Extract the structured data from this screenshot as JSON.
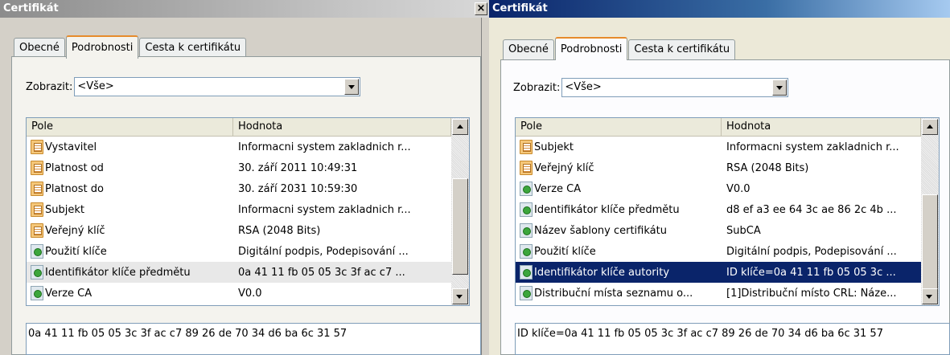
{
  "left": {
    "title": "Certifikát",
    "close_label": "×",
    "tabs": [
      "Obecné",
      "Podrobnosti",
      "Cesta k certifikátu"
    ],
    "show_label": "Zobrazit:",
    "show_value": "<Vše>",
    "columns": [
      "Pole",
      "Hodnota"
    ],
    "rows": [
      {
        "icon": "document-icon",
        "field": "Vystavitel",
        "value": "Informacni system zakladnich r..."
      },
      {
        "icon": "document-icon",
        "field": "Platnost od",
        "value": "30. září 2011 10:49:31"
      },
      {
        "icon": "document-icon",
        "field": "Platnost do",
        "value": "30. září 2031 10:59:30"
      },
      {
        "icon": "document-icon",
        "field": "Subjekt",
        "value": "Informacni system zakladnich r..."
      },
      {
        "icon": "document-icon",
        "field": "Veřejný klíč",
        "value": "RSA (2048 Bits)"
      },
      {
        "icon": "extension-icon",
        "field": "Použití klíče",
        "value": "Digitální podpis, Podepisování ..."
      },
      {
        "icon": "extension-icon",
        "field": "Identifikátor klíče předmětu",
        "value": "0a 41 11 fb 05 05 3c 3f ac c7 ..."
      },
      {
        "icon": "extension-icon",
        "field": "Verze CA",
        "value": "V0.0"
      }
    ],
    "selected_row": 6,
    "detail": "0a 41 11 fb 05 05 3c 3f ac c7 89 26 de 70 34 d6 ba 6c 31 57"
  },
  "right": {
    "title": "Certifikát",
    "close_label": "×",
    "tabs": [
      "Obecné",
      "Podrobnosti",
      "Cesta k certifikátu"
    ],
    "show_label": "Zobrazit:",
    "show_value": "<Vše>",
    "columns": [
      "Pole",
      "Hodnota"
    ],
    "rows": [
      {
        "icon": "document-icon",
        "field": "Subjekt",
        "value": "Informacni system zakladnich r..."
      },
      {
        "icon": "document-icon",
        "field": "Veřejný klíč",
        "value": "RSA (2048 Bits)"
      },
      {
        "icon": "extension-icon",
        "field": "Verze CA",
        "value": "V0.0"
      },
      {
        "icon": "extension-icon",
        "field": "Identifikátor klíče předmětu",
        "value": "d8 ef a3 ee 64 3c ae 86 2c 4b ..."
      },
      {
        "icon": "extension-icon",
        "field": "Název šablony certifikátu",
        "value": "SubCA"
      },
      {
        "icon": "extension-icon",
        "field": "Použití klíče",
        "value": "Digitální podpis, Podepisování ..."
      },
      {
        "icon": "extension-icon",
        "field": "Identifikátor klíče autority",
        "value": "ID klíče=0a 41 11 fb 05 05 3c ..."
      },
      {
        "icon": "extension-icon",
        "field": "Distribuční místa seznamu o...",
        "value": "[1]Distribuční místo CRL: Náze..."
      }
    ],
    "selected_row": 6,
    "detail": "ID klíče=0a 41 11 fb 05 05 3c 3f ac c7 89 26 de 70 34 d6 ba 6c 31 57"
  }
}
